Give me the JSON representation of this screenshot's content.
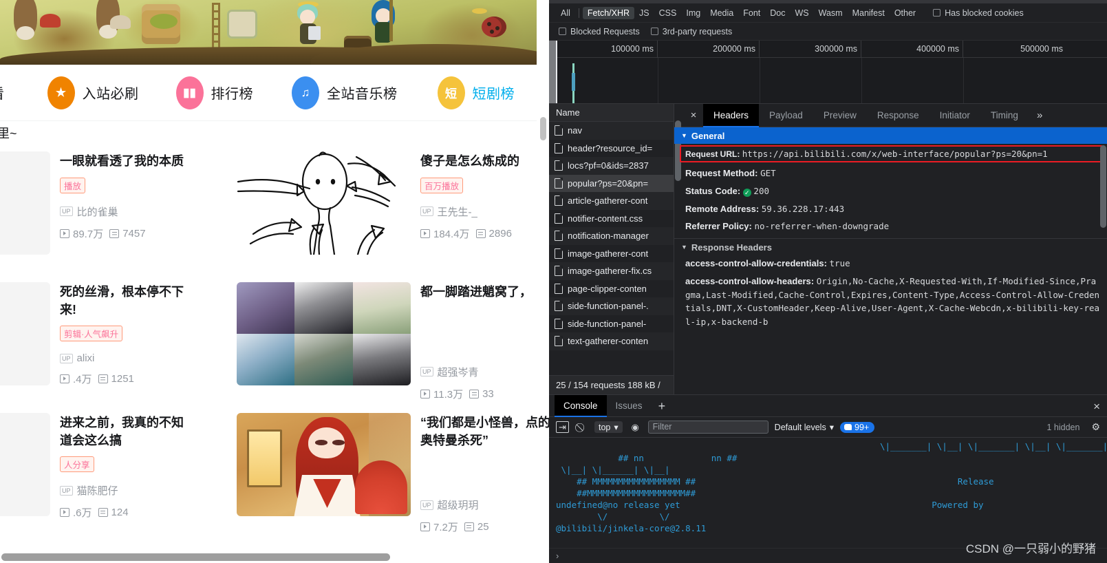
{
  "page": {
    "nav_items": [
      {
        "label": "看",
        "icon": "partial-icon",
        "color": "",
        "partial": true
      },
      {
        "label": "入站必刷",
        "icon": "medal-icon",
        "color": "#f08300"
      },
      {
        "label": "排行榜",
        "icon": "chart-bars-icon",
        "color": "#fb7299"
      },
      {
        "label": "全站音乐榜",
        "icon": "headphones-icon",
        "color": "#3b8ff0"
      },
      {
        "label": "短剧榜",
        "icon": "short-drama-icon",
        "color": "#f5c33b",
        "label_blue": true,
        "glyph": "短"
      }
    ],
    "top_text": "里~",
    "cards": [
      {
        "title": "一眼就看透了我的本质",
        "badge": "播放",
        "up": "比的雀巢",
        "plays": "89.7万",
        "danmaku": "7457",
        "thumb": "cut-off"
      },
      {
        "title": "傻子是怎么炼成的",
        "badge": "百万播放",
        "up": "王先生-_",
        "plays": "184.4万",
        "danmaku": "2896",
        "thumb": "stick-figure-doodle"
      },
      {
        "title": "死的丝滑，根本停不下来!",
        "badge": "剪辑·人气飙升",
        "up": "alixi",
        "plays": ".4万",
        "danmaku": "1251",
        "thumb": "cut-off"
      },
      {
        "title": "都一脚踏进魈窝了，",
        "badge": "",
        "up": "超强岑青",
        "plays": "11.3万",
        "danmaku": "33",
        "thumb": "cosplay-grid"
      },
      {
        "title": "进来之前，我真的不知道会这么搞",
        "badge": "人分享",
        "up": "猫陈肥仔",
        "plays": ".6万",
        "danmaku": "124",
        "thumb": "cut-off"
      },
      {
        "title": "“我们都是小怪兽，点的奥特曼杀死”",
        "badge": "",
        "up": "超级玥玥",
        "plays": "7.2万",
        "danmaku": "25",
        "thumb": "red-hair-cosplay"
      }
    ]
  },
  "devtools": {
    "filters": {
      "types": [
        "All",
        "Fetch/XHR",
        "JS",
        "CSS",
        "Img",
        "Media",
        "Font",
        "Doc",
        "WS",
        "Wasm",
        "Manifest",
        "Other"
      ],
      "selected_type": "Fetch/XHR",
      "has_blocked_cookies": "Has blocked cookies",
      "blocked_requests": "Blocked Requests",
      "third_party": "3rd-party requests"
    },
    "overview": {
      "ticks": [
        "100000 ms",
        "200000 ms",
        "300000 ms",
        "400000 ms",
        "500000 ms"
      ]
    },
    "network": {
      "column_header": "Name",
      "rows": [
        "nav",
        "header?resource_id=",
        "locs?pf=0&ids=2837",
        "popular?ps=20&pn=",
        "article-gatherer-cont",
        "notifier-content.css",
        "notification-manager",
        "image-gatherer-cont",
        "image-gatherer-fix.cs",
        "page-clipper-conten",
        "side-function-panel-.",
        "side-function-panel-",
        "text-gatherer-conten"
      ],
      "selected_row": 3,
      "summary": "25 / 154 requests   188 kB /"
    },
    "detail_tabs": {
      "tabs": [
        "Headers",
        "Payload",
        "Preview",
        "Response",
        "Initiator",
        "Timing"
      ],
      "selected": "Headers",
      "more": "»",
      "close": "×"
    },
    "general": {
      "section_title": "General",
      "request_url_key": "Request URL:",
      "request_url_value": "https://api.bilibili.com/x/web-interface/popular?ps=20&pn=1",
      "request_method_key": "Request Method:",
      "request_method_value": "GET",
      "status_code_key": "Status Code:",
      "status_code_value": "200",
      "remote_address_key": "Remote Address:",
      "remote_address_value": "59.36.228.17:443",
      "referrer_policy_key": "Referrer Policy:",
      "referrer_policy_value": "no-referrer-when-downgrade"
    },
    "response_headers": {
      "section_title": "Response Headers",
      "items": [
        {
          "key": "access-control-allow-credentials:",
          "value": "true"
        },
        {
          "key": "access-control-allow-headers:",
          "value": "Origin,No-Cache,X-Requested-With,If-Modified-Since,Pragma,Last-Modified,Cache-Control,Expires,Content-Type,Access-Control-Allow-Credentials,DNT,X-CustomHeader,Keep-Alive,User-Agent,X-Cache-Webcdn,x-bilibili-key-real-ip,x-backend-b"
        }
      ]
    },
    "console": {
      "tabs": [
        "Console",
        "Issues"
      ],
      "selected_tab": "Console",
      "add": "+",
      "close": "×",
      "context": "top",
      "filter_placeholder": "Filter",
      "levels": "Default levels",
      "badge_count": "99+",
      "hidden": "1 hidden",
      "log_left": "    ## nn             nn ##\n \\|__| \\|______| \\|__|\n    ## MMMMMMMMMMMMMMMMM ##\n    ##MMMMMMMMMMMMMMMMMMM##\nundefined@no release yet\n        \\/          \\/\n@bilibili/jinkela-core@2.8.11",
      "log_right": "\\|_______| \\|__| \\|_______| \\|__| \\|_______|\n\n\n               Release\n\n          Powered by",
      "prompt": "›"
    },
    "watermark": "CSDN @一只弱小的野猪"
  }
}
